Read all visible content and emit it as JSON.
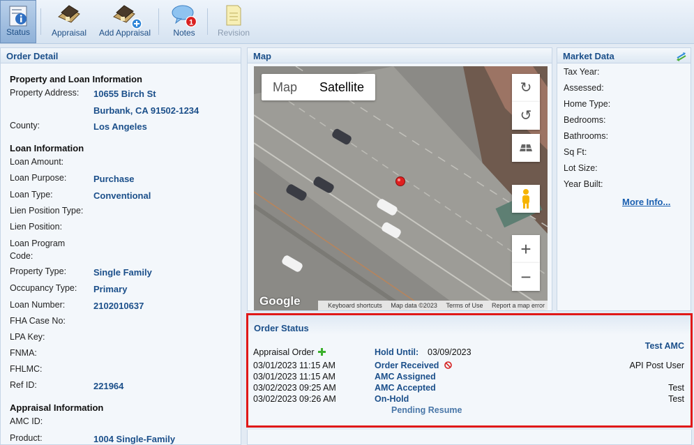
{
  "toolbar": {
    "items": [
      {
        "label": "Status",
        "icon": "status-info-icon"
      },
      {
        "label": "Appraisal",
        "icon": "house-icon"
      },
      {
        "label": "Add Appraisal",
        "icon": "house-add-icon"
      },
      {
        "label": "Notes",
        "icon": "notes-bubble-icon",
        "badge": "1"
      },
      {
        "label": "Revision",
        "icon": "revision-document-icon"
      }
    ]
  },
  "order_detail": {
    "title": "Order Detail",
    "property_section": "Property and Loan Information",
    "property_address_label": "Property Address:",
    "property_address_line1": "10655 Birch St",
    "property_address_line2": "Burbank, CA 91502-1234",
    "county_label": "County:",
    "county_value": "Los Angeles",
    "loan_section": "Loan Information",
    "loan_amount_label": "Loan Amount:",
    "loan_purpose_label": "Loan Purpose:",
    "loan_purpose_value": "Purchase",
    "loan_type_label": "Loan Type:",
    "loan_type_value": "Conventional",
    "lien_position_type_label": "Lien Position Type:",
    "lien_position_label": "Lien Position:",
    "loan_program_code_label_1": "Loan Program",
    "loan_program_code_label_2": "Code:",
    "property_type_label": "Property Type:",
    "property_type_value": "Single Family",
    "occupancy_type_label": "Occupancy Type:",
    "occupancy_type_value": "Primary",
    "loan_number_label": "Loan Number:",
    "loan_number_value": "2102010637",
    "fha_case_label": "FHA Case No:",
    "lpa_key_label": "LPA Key:",
    "fnma_label": "FNMA:",
    "fhlmc_label": "FHLMC:",
    "ref_id_label": "Ref ID:",
    "ref_id_value": "221964",
    "appraisal_section": "Appraisal Information",
    "amc_id_label": "AMC ID:",
    "product_label": "Product:",
    "product_value": "1004 Single-Family"
  },
  "map": {
    "title": "Map",
    "toggle_map": "Map",
    "toggle_satellite": "Satellite",
    "google_logo": "Google",
    "footer": {
      "shortcuts": "Keyboard shortcuts",
      "data": "Map data ©2023",
      "terms": "Terms of Use",
      "report": "Report a map error"
    }
  },
  "market_data": {
    "title": "Market Data",
    "fields": [
      "Tax Year:",
      "Assessed:",
      "Home Type:",
      "Bedrooms:",
      "Bathrooms:",
      "Sq Ft:",
      "Lot Size:",
      "Year Built:"
    ],
    "more_info": "More Info..."
  },
  "order_status": {
    "title": "Order Status",
    "order_label": "Appraisal Order",
    "hold_until_label": "Hold Until:",
    "hold_until_value": "03/09/2023",
    "amc_name": "Test AMC",
    "events": [
      {
        "time": "03/01/2023 11:15 AM",
        "status": "Order Received",
        "user": "API Post User"
      },
      {
        "time": "03/01/2023 11:15 AM",
        "status": "AMC Assigned",
        "user": ""
      },
      {
        "time": "03/02/2023 09:25 AM",
        "status": "AMC Accepted",
        "user": "Test"
      },
      {
        "time": "03/02/2023 09:26 AM",
        "status": "On-Hold",
        "user": "Test"
      }
    ],
    "pending": "Pending Resume"
  },
  "colors": {
    "accent": "#1b4f8a",
    "highlight_border": "#e01818",
    "link": "#1a5fb0"
  }
}
